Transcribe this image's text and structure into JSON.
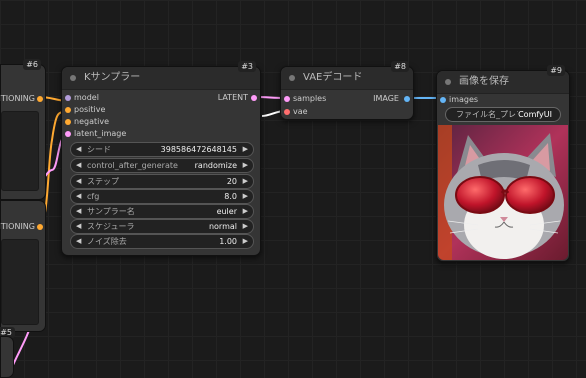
{
  "ksampler": {
    "id": "#3",
    "title": "Kサンプラー",
    "inputs": [
      "model",
      "positive",
      "negative",
      "latent_image"
    ],
    "output": "LATENT",
    "widgets": [
      {
        "label": "シード",
        "value": "398586472648145"
      },
      {
        "label": "control_after_generate",
        "value": "randomize"
      },
      {
        "label": "ステップ",
        "value": "20"
      },
      {
        "label": "cfg",
        "value": "8.0"
      },
      {
        "label": "サンプラー名",
        "value": "euler"
      },
      {
        "label": "スケジューラ",
        "value": "normal"
      },
      {
        "label": "ノイズ除去",
        "value": "1.00"
      }
    ]
  },
  "vae_decode": {
    "id": "#8",
    "title": "VAEデコード",
    "inputs": [
      "samples",
      "vae"
    ],
    "output": "IMAGE"
  },
  "save_image": {
    "id": "#9",
    "title": "画像を保存",
    "input": "images",
    "filename_value": "ファイル名_プレフ",
    "filename_overlay": "ComfyUI",
    "preview_icon": "cat-with-red-sunglasses-image"
  },
  "left_nodes": {
    "top_id": "#6",
    "top_output": "CONDITIONING",
    "middle_output": "CONDITIONING",
    "bottom_id": "#5"
  },
  "colors": {
    "model_port": "#b39ddb",
    "conditioning_port": "#ffa931",
    "latent_port": "#ff9cf9",
    "image_port": "#64b5f6",
    "vae_port": "#ff6e6e"
  }
}
